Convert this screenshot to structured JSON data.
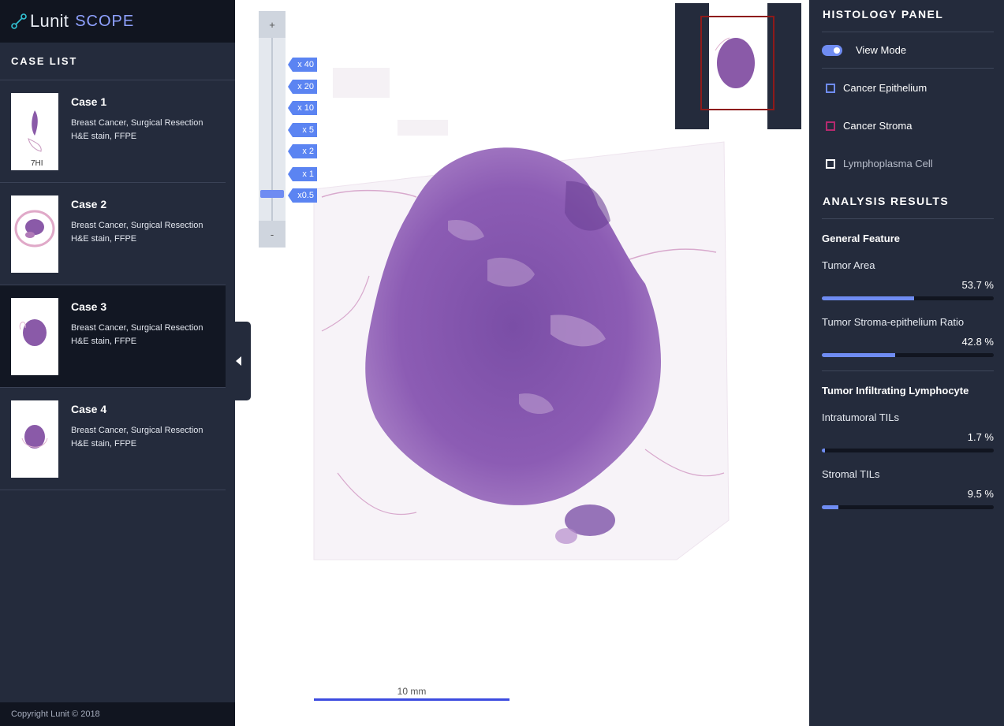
{
  "brand": {
    "name": "Lunit",
    "product": "SCOPE"
  },
  "case_list": {
    "title": "CASE LIST",
    "cases": [
      {
        "name": "Case 1",
        "line1": "Breast Cancer, Surgical Resection",
        "line2": "H&E stain, FFPE",
        "active": false
      },
      {
        "name": "Case 2",
        "line1": "Breast Cancer, Surgical Resection",
        "line2": "H&E stain, FFPE",
        "active": false
      },
      {
        "name": "Case 3",
        "line1": "Breast Cancer, Surgical Resection",
        "line2": "H&E stain, FFPE",
        "active": true
      },
      {
        "name": "Case 4",
        "line1": "Breast Cancer, Surgical Resection",
        "line2": "H&E stain, FFPE",
        "active": false
      }
    ]
  },
  "footer": {
    "copyright": "Copyright Lunit © 2018"
  },
  "viewer": {
    "zoom": {
      "plus": "+",
      "minus": "-",
      "levels": [
        "x 40",
        "x 20",
        "x 10",
        "x 5",
        "x 2",
        "x 1",
        "x0.5"
      ],
      "current": "x0.5"
    },
    "scalebar": "10 mm"
  },
  "histology_panel": {
    "title": "HISTOLOGY PANEL",
    "view_mode": {
      "label": "View Mode",
      "on": true
    },
    "legend": [
      {
        "label": "Cancer Epithelium",
        "color": "#6f8cf2"
      },
      {
        "label": "Cancer Stroma",
        "color": "#b5296f"
      },
      {
        "label": "Lymphoplasma Cell",
        "color": "#ffffff"
      }
    ]
  },
  "analysis_results": {
    "title": "ANALYSIS RESULTS",
    "groups": [
      {
        "name": "General Feature",
        "metrics": [
          {
            "label": "Tumor Area",
            "value": "53.7 %",
            "fraction": 0.537
          },
          {
            "label": "Tumor Stroma-epithelium Ratio",
            "value": "42.8 %",
            "fraction": 0.428
          }
        ]
      },
      {
        "name": "Tumor Infiltrating Lymphocyte",
        "metrics": [
          {
            "label": "Intratumoral TILs",
            "value": "1.7 %",
            "fraction": 0.017
          },
          {
            "label": "Stromal TILs",
            "value": "9.5 %",
            "fraction": 0.095
          }
        ]
      }
    ]
  },
  "colors": {
    "accent": "#6f8cf2",
    "sidebar": "#242b3c",
    "scalebar": "#3c4be0",
    "minimap_frame": "#8e1a1a"
  }
}
